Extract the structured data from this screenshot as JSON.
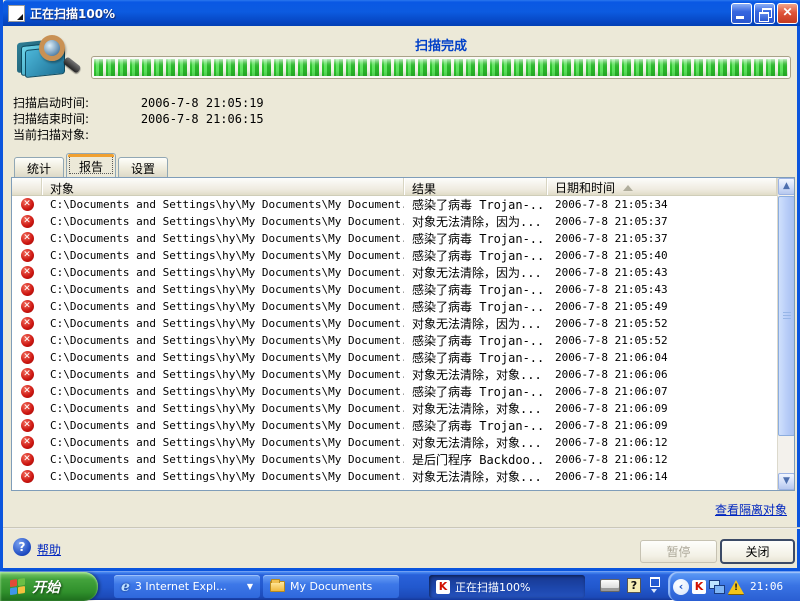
{
  "window": {
    "title": "正在扫描100%",
    "status_heading": "扫描完成",
    "progress_percent": 100
  },
  "scan_info": {
    "rows": [
      {
        "label": "扫描启动时间:",
        "value": "2006-7-8 21:05:19"
      },
      {
        "label": "扫描结束时间:",
        "value": "2006-7-8 21:06:15"
      },
      {
        "label": "当前扫描对象:",
        "value": ""
      }
    ]
  },
  "tabs": [
    {
      "label": "统计"
    },
    {
      "label": "报告"
    },
    {
      "label": "设置"
    }
  ],
  "table": {
    "columns": {
      "object": "对象",
      "result": "结果",
      "datetime": "日期和时间"
    },
    "rows": [
      {
        "object": "C:\\Documents and Settings\\hy\\My Documents\\My Document...",
        "result": "感染了病毒 Trojan-...",
        "datetime": "2006-7-8 21:05:34"
      },
      {
        "object": "C:\\Documents and Settings\\hy\\My Documents\\My Document...",
        "result": "对象无法清除，因为...",
        "datetime": "2006-7-8 21:05:37"
      },
      {
        "object": "C:\\Documents and Settings\\hy\\My Documents\\My Document...",
        "result": "感染了病毒 Trojan-...",
        "datetime": "2006-7-8 21:05:37"
      },
      {
        "object": "C:\\Documents and Settings\\hy\\My Documents\\My Document...",
        "result": "感染了病毒 Trojan-...",
        "datetime": "2006-7-8 21:05:40"
      },
      {
        "object": "C:\\Documents and Settings\\hy\\My Documents\\My Document...",
        "result": "对象无法清除，因为...",
        "datetime": "2006-7-8 21:05:43"
      },
      {
        "object": "C:\\Documents and Settings\\hy\\My Documents\\My Document...",
        "result": "感染了病毒 Trojan-...",
        "datetime": "2006-7-8 21:05:43"
      },
      {
        "object": "C:\\Documents and Settings\\hy\\My Documents\\My Document...",
        "result": "感染了病毒 Trojan-...",
        "datetime": "2006-7-8 21:05:49"
      },
      {
        "object": "C:\\Documents and Settings\\hy\\My Documents\\My Document...",
        "result": "对象无法清除，因为...",
        "datetime": "2006-7-8 21:05:52"
      },
      {
        "object": "C:\\Documents and Settings\\hy\\My Documents\\My Document...",
        "result": "感染了病毒 Trojan-...",
        "datetime": "2006-7-8 21:05:52"
      },
      {
        "object": "C:\\Documents and Settings\\hy\\My Documents\\My Document...",
        "result": "感染了病毒 Trojan-...",
        "datetime": "2006-7-8 21:06:04"
      },
      {
        "object": "C:\\Documents and Settings\\hy\\My Documents\\My Document...",
        "result": "对象无法清除，对象...",
        "datetime": "2006-7-8 21:06:06"
      },
      {
        "object": "C:\\Documents and Settings\\hy\\My Documents\\My Document...",
        "result": "感染了病毒 Trojan-...",
        "datetime": "2006-7-8 21:06:07"
      },
      {
        "object": "C:\\Documents and Settings\\hy\\My Documents\\My Document...",
        "result": "对象无法清除，对象...",
        "datetime": "2006-7-8 21:06:09"
      },
      {
        "object": "C:\\Documents and Settings\\hy\\My Documents\\My Document...",
        "result": "感染了病毒 Trojan-...",
        "datetime": "2006-7-8 21:06:09"
      },
      {
        "object": "C:\\Documents and Settings\\hy\\My Documents\\My Document...",
        "result": "对象无法清除，对象...",
        "datetime": "2006-7-8 21:06:12"
      },
      {
        "object": "C:\\Documents and Settings\\hy\\My Documents\\My Document...",
        "result": "是后门程序 Backdoo...",
        "datetime": "2006-7-8 21:06:12"
      },
      {
        "object": "C:\\Documents and Settings\\hy\\My Documents\\My Document...",
        "result": "对象无法清除，对象...",
        "datetime": "2006-7-8 21:06:14"
      }
    ]
  },
  "footer": {
    "quarantine_link": "查看隔离对象",
    "help_label": "帮助",
    "pause_button": "暂停",
    "close_button": "关闭"
  },
  "taskbar": {
    "start_label": "开始",
    "tasks": [
      {
        "label": "3 Internet Expl..."
      },
      {
        "label": "My Documents"
      },
      {
        "label": "正在扫描100%"
      }
    ],
    "clock": "21:06"
  },
  "colors": {
    "titlebar_blue": "#0c5be0",
    "heading_blue": "#0040c8",
    "progress_green": "#2ec32e",
    "link_blue": "#0026bf",
    "alert_red": "#cc1510"
  }
}
